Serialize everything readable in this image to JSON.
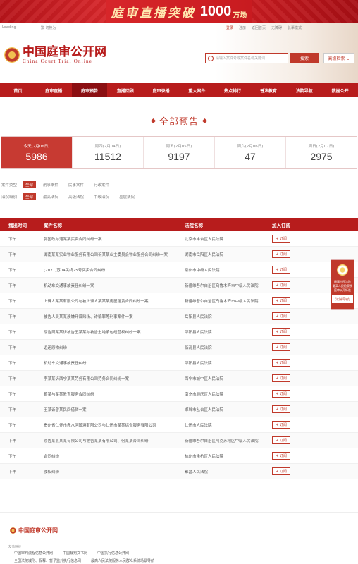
{
  "banner": {
    "text": "庭审直播突破",
    "number": "1000",
    "unit": "万场"
  },
  "topbar": {
    "loading": "Loading",
    "lang": "繁 切换为",
    "links": [
      "登录",
      "注册",
      "返回首页",
      "无障碍",
      "长辈模式"
    ]
  },
  "logo": {
    "cn": "中国庭审公开网",
    "en": "China Court Trial Online"
  },
  "search": {
    "placeholder": "请输入案件号或案件名称关键词",
    "button": "搜索",
    "advanced": "高级检索 ⌄"
  },
  "nav": [
    {
      "label": "首页",
      "active": false
    },
    {
      "label": "庭审直播",
      "active": false
    },
    {
      "label": "庭审预告",
      "active": true
    },
    {
      "label": "直播回顾",
      "active": false
    },
    {
      "label": "庭审录播",
      "active": false
    },
    {
      "label": "重大案件",
      "active": false
    },
    {
      "label": "热点排行",
      "active": false
    },
    {
      "label": "普法教育",
      "active": false
    },
    {
      "label": "法院导航",
      "active": false
    },
    {
      "label": "数据公开",
      "active": false
    }
  ],
  "section_title": "全部预告",
  "stats": [
    {
      "label": "今天(2月06日)",
      "value": "5986",
      "active": true
    },
    {
      "label": "周四(2月04日)",
      "value": "11512",
      "active": false
    },
    {
      "label": "周五(2月05日)",
      "value": "9197",
      "active": false
    },
    {
      "label": "周六(2月06日)",
      "value": "47",
      "active": false
    },
    {
      "label": "周日(2月07日)",
      "value": "2975",
      "active": false
    }
  ],
  "filters": {
    "case_type": {
      "label": "案件类型",
      "options": [
        "全部",
        "刑事案件",
        "民事案件",
        "行政案件"
      ],
      "selected": "全部"
    },
    "court_level": {
      "label": "法院级别",
      "options": [
        "全部",
        "最高法院",
        "高级法院",
        "中级法院",
        "基层法院"
      ],
      "selected": "全部"
    }
  },
  "table": {
    "headers": [
      "播出时间",
      "案件名称",
      "法院名称",
      "加入订阅"
    ],
    "subscribe_label": "+ 订阅",
    "rows": [
      {
        "time": "下午",
        "case": "郭国政与潘某某买卖合同纠纷一案",
        "court": "北京市丰台区人民法院"
      },
      {
        "time": "下午",
        "case": "湖南某某实业物业服务有限公司诉某某业主委员会物业服务合同纠纷一案",
        "court": "湖南市岳阳区人民法院"
      },
      {
        "time": "下午",
        "case": "(2021)苏04民终25号买卖合同纠纷",
        "court": "常州市中级人民法院"
      },
      {
        "time": "下午",
        "case": "机动车交通事故责任纠纷一案",
        "court": "新疆维吾尔自治区乌鲁木齐市中级人民法院"
      },
      {
        "time": "下午",
        "case": "上诉人某某有限公司与被上诉人某某某房屋租赁合同纠纷一案",
        "court": "新疆维吾尔自治区乌鲁木齐市中级人民法院"
      },
      {
        "time": "下午",
        "case": "被告人吴某某涉嫌开设赌场、诈骗罪等刑事案件一案",
        "court": "岳阳县人民法院"
      },
      {
        "time": "下午",
        "case": "原告周某某诉被告王某某与被告土地承包经营权纠纷一案",
        "court": "邵阳县人民法院"
      },
      {
        "time": "下午",
        "case": "返还原物纠纷",
        "court": "临汾县人民法院"
      },
      {
        "time": "下午",
        "case": "机动车交通事故责任纠纷",
        "court": "邵阳县人民法院"
      },
      {
        "time": "下午",
        "case": "李某某诉西宁某某劳务有限公司劳务合同纠纷一案",
        "court": "西宁市城中区人民法院"
      },
      {
        "time": "下午",
        "case": "翟某与某某教育服务合同纠纷",
        "court": "南充市顺庆区人民法院"
      },
      {
        "time": "下午",
        "case": "王某诉曾某民间借贷一案",
        "court": "邯郸市丛台区人民法院"
      },
      {
        "time": "下午",
        "case": "贵州省仁怀市赤水河酿酒有限公司与仁怀市某某综合服务有限公司",
        "court": "仁怀市人民法院"
      },
      {
        "time": "下午",
        "case": "原告某县某某有限公司与被告某某有限公司、何某某合同纠纷",
        "court": "新疆维吾尔自治区阿克苏地区中级人民法院"
      },
      {
        "time": "下午",
        "case": "合同纠纷",
        "court": "杭州市余杭区人民法院"
      },
      {
        "time": "下午",
        "case": "侵权纠纷",
        "court": "都昌人民法院"
      }
    ]
  },
  "float_widget": {
    "text": "最高人民法院 最高人民检察院 庭审公开标准",
    "button": "法院导航"
  },
  "footer": {
    "logo": "中国庭审公开网",
    "links_label": "友情链接",
    "links_row1": [
      "中国审判流程信息公开网",
      "中国裁判文书网",
      "中国执行信息公开网"
    ],
    "links_row2": [
      "全国法院减刑、假释、暂予监外执行信息网",
      "最高人民法院服务人民群众系统场景导航"
    ]
  }
}
